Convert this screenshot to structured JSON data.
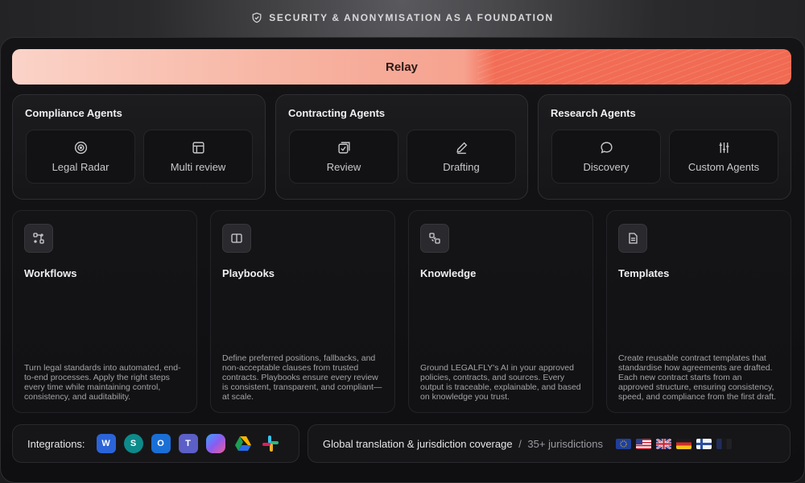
{
  "banner": {
    "text": "SECURITY & ANONYMISATION AS A FOUNDATION",
    "icon": "shield-check-icon"
  },
  "relay": {
    "label": "Relay"
  },
  "agent_groups": [
    {
      "title": "Compliance Agents",
      "agents": [
        {
          "label": "Legal Radar",
          "icon": "radar-icon"
        },
        {
          "label": "Multi review",
          "icon": "table-icon"
        }
      ]
    },
    {
      "title": "Contracting Agents",
      "agents": [
        {
          "label": "Review",
          "icon": "checkbox-stack-icon"
        },
        {
          "label": "Drafting",
          "icon": "pencil-icon"
        }
      ]
    },
    {
      "title": "Research Agents",
      "agents": [
        {
          "label": "Discovery",
          "icon": "chat-bubble-icon"
        },
        {
          "label": "Custom Agents",
          "icon": "sliders-icon"
        }
      ]
    }
  ],
  "features": [
    {
      "title": "Workflows",
      "icon": "workflow-icon",
      "description": "Turn legal standards into automated, end-to-end processes. Apply the right steps every time while maintaining control, consistency, and auditability."
    },
    {
      "title": "Playbooks",
      "icon": "book-icon",
      "description": "Define preferred positions, fallbacks, and non-acceptable clauses from trusted contracts. Playbooks ensure every review is consistent, transparent, and compliant—at scale."
    },
    {
      "title": "Knowledge",
      "icon": "knowledge-icon",
      "description": "Ground LEGALFLY's AI in your approved policies, contracts, and sources. Every output is traceable, explainable, and based on knowledge you trust."
    },
    {
      "title": "Templates",
      "icon": "document-icon",
      "description": "Create reusable contract templates that standardise how agreements are drafted. Each new contract starts from an approved structure, ensuring consistency, speed, and compliance from the first draft."
    }
  ],
  "integrations": {
    "label": "Integrations:",
    "apps": [
      {
        "name": "word-icon",
        "letter": "W",
        "color": "#2b64d9"
      },
      {
        "name": "sharepoint-icon",
        "letter": "S",
        "color": "#0d8a8a"
      },
      {
        "name": "outlook-icon",
        "letter": "O",
        "color": "#1a6fd6"
      },
      {
        "name": "teams-icon",
        "letter": "T",
        "color": "#5b5fc7"
      },
      {
        "name": "copilot-icon",
        "letter": "",
        "color": "#8a5cf0"
      },
      {
        "name": "google-drive-icon",
        "letter": "",
        "color": "#1e9e54"
      },
      {
        "name": "slack-icon",
        "letter": "",
        "color": "#d6336c"
      }
    ]
  },
  "coverage": {
    "text": "Global translation & jurisdiction coverage",
    "separator": " / ",
    "count": "35+ jurisdictions",
    "flags": [
      "eu-flag-icon",
      "us-flag-icon",
      "uk-flag-icon",
      "de-flag-icon",
      "fi-flag-icon",
      "fr-flag-icon"
    ]
  }
}
